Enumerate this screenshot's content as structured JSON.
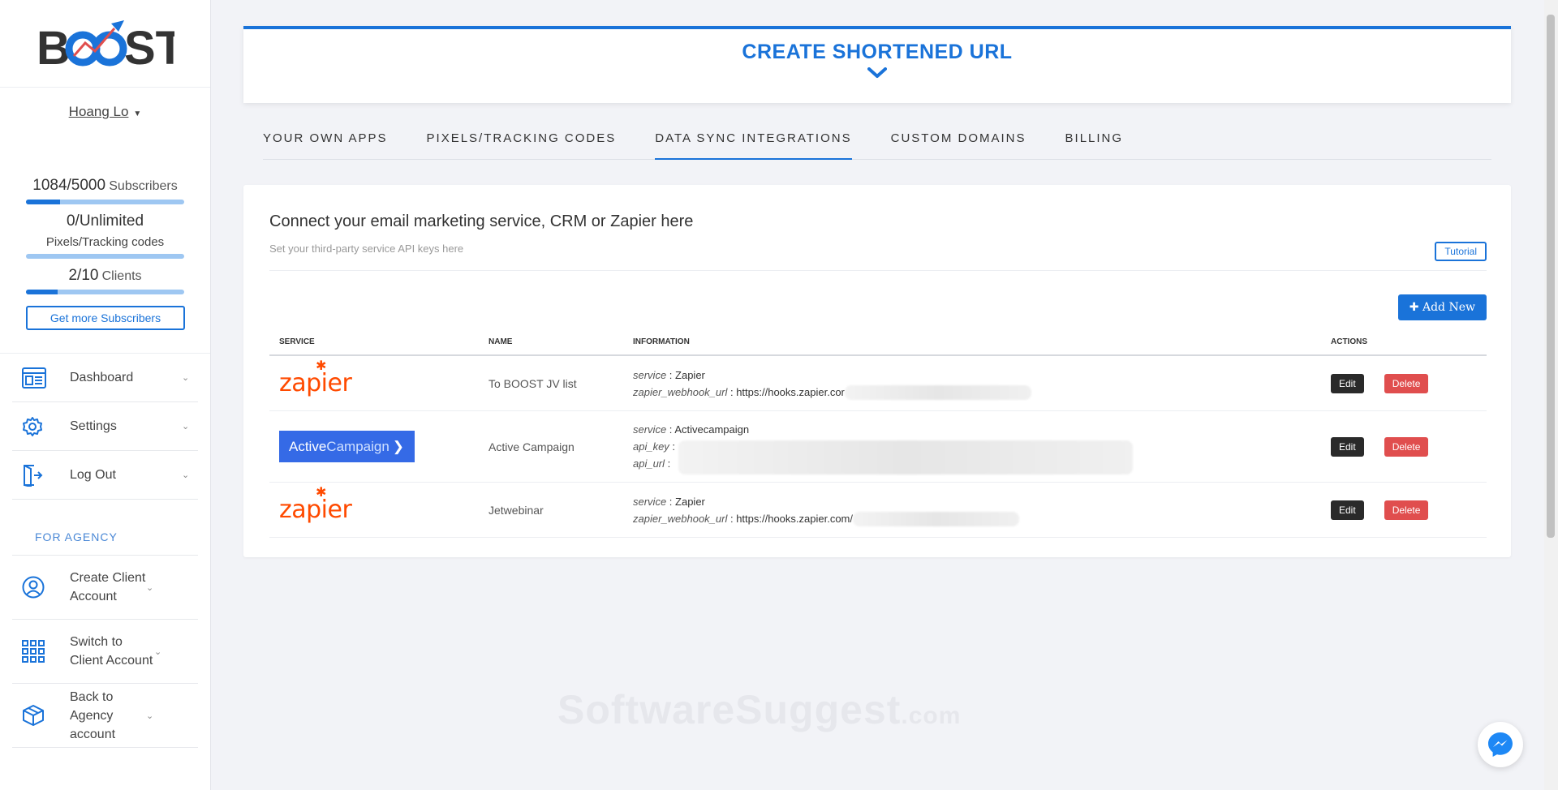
{
  "app": {
    "logo_text": "BOOST"
  },
  "user": {
    "name": "Hoang Lo"
  },
  "quota": {
    "subscribers": {
      "count": "1084/5000",
      "unit": "Subscribers",
      "fill": 0.217
    },
    "pixels": {
      "count": "0/Unlimited",
      "unit": "Pixels/Tracking codes",
      "fill": 0
    },
    "clients": {
      "count": "2/10",
      "unit": "Clients",
      "fill": 0.2
    },
    "more_button": "Get more Subscribers"
  },
  "nav": {
    "items": [
      {
        "label": "Dashboard",
        "icon": "dashboard-icon"
      },
      {
        "label": "Settings",
        "icon": "gear-icon"
      },
      {
        "label": "Log Out",
        "icon": "logout-icon"
      }
    ],
    "agency_title": "FOR AGENCY",
    "agency_items": [
      {
        "label": "Create Client Account",
        "icon": "user-circle-icon"
      },
      {
        "label": "Switch to Client Account",
        "icon": "grid-icon"
      },
      {
        "label": "Back to Agency account",
        "icon": "box-icon"
      }
    ]
  },
  "hero": {
    "title": "CREATE SHORTENED URL"
  },
  "tabs": [
    {
      "label": "YOUR OWN APPS"
    },
    {
      "label": "PIXELS/TRACKING CODES"
    },
    {
      "label": "DATA SYNC INTEGRATIONS",
      "active": true
    },
    {
      "label": "CUSTOM DOMAINS"
    },
    {
      "label": "BILLING"
    }
  ],
  "card": {
    "title": "Connect your email marketing service, CRM or Zapier here",
    "subtitle": "Set your third-party service API keys here",
    "tutorial_button": "Tutorial",
    "add_button": "Add New"
  },
  "table": {
    "headers": {
      "service": "SERVICE",
      "name": "NAME",
      "information": "INFORMATION",
      "actions": "ACTIONS"
    },
    "edit_label": "Edit",
    "delete_label": "Delete",
    "rows": [
      {
        "logo": "zapier",
        "name": "To BOOST JV list",
        "info": [
          {
            "key": "service",
            "value": "Zapier"
          },
          {
            "key": "zapier_webhook_url",
            "value": "https://hooks.zapier.cor"
          }
        ]
      },
      {
        "logo": "activecampaign",
        "logo_text_a": "Active",
        "logo_text_b": "Campaign",
        "name": "Active Campaign",
        "info": [
          {
            "key": "service",
            "value": "Activecampaign"
          },
          {
            "key": "api_key",
            "value": ""
          },
          {
            "key": "api_url",
            "value": ""
          }
        ]
      },
      {
        "logo": "zapier",
        "name": "Jetwebinar",
        "info": [
          {
            "key": "service",
            "value": "Zapier"
          },
          {
            "key": "zapier_webhook_url",
            "value": "https://hooks.zapier.com/"
          }
        ]
      }
    ]
  },
  "watermark": {
    "main": "SoftwareSuggest",
    "suffix": ".com"
  },
  "colors": {
    "accent": "#1a73d9",
    "danger": "#e04e4e",
    "dark": "#2a2a2a",
    "zapier": "#ff4a00",
    "activecampaign": "#356ae6"
  }
}
